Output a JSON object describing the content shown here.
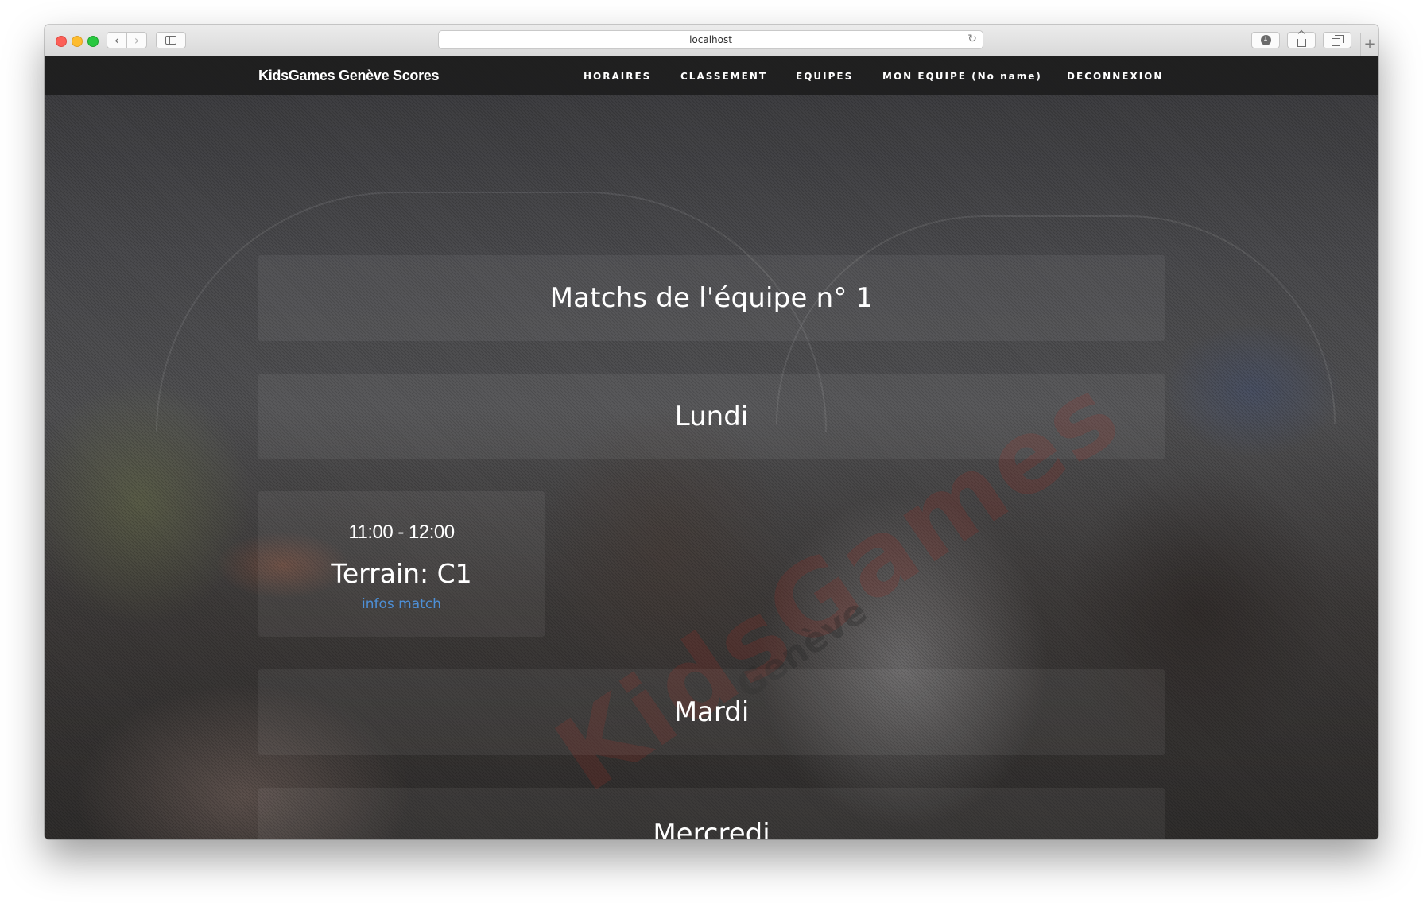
{
  "browser": {
    "url": "localhost"
  },
  "navbar": {
    "brand": "KidsGames Genève Scores",
    "items": [
      {
        "label": "HORAIRES"
      },
      {
        "label": "CLASSEMENT"
      },
      {
        "label": "EQUIPES"
      },
      {
        "label": "MON EQUIPE (No name)"
      },
      {
        "label": "DECONNEXION"
      }
    ]
  },
  "page": {
    "title": "Matchs de l'équipe n° 1",
    "days": [
      {
        "name": "Lundi",
        "matches": [
          {
            "time": "11:00 - 12:00",
            "field": "Terrain: C1",
            "link": "infos match"
          }
        ]
      },
      {
        "name": "Mardi",
        "matches": []
      },
      {
        "name": "Mercredi",
        "matches": []
      }
    ]
  },
  "watermark": {
    "logo_text": "KidsGames",
    "logo_subtext": "Genève"
  },
  "colors": {
    "link": "#4d8fd6",
    "navbar": "#1c1c1c",
    "text": "#ffffff"
  }
}
